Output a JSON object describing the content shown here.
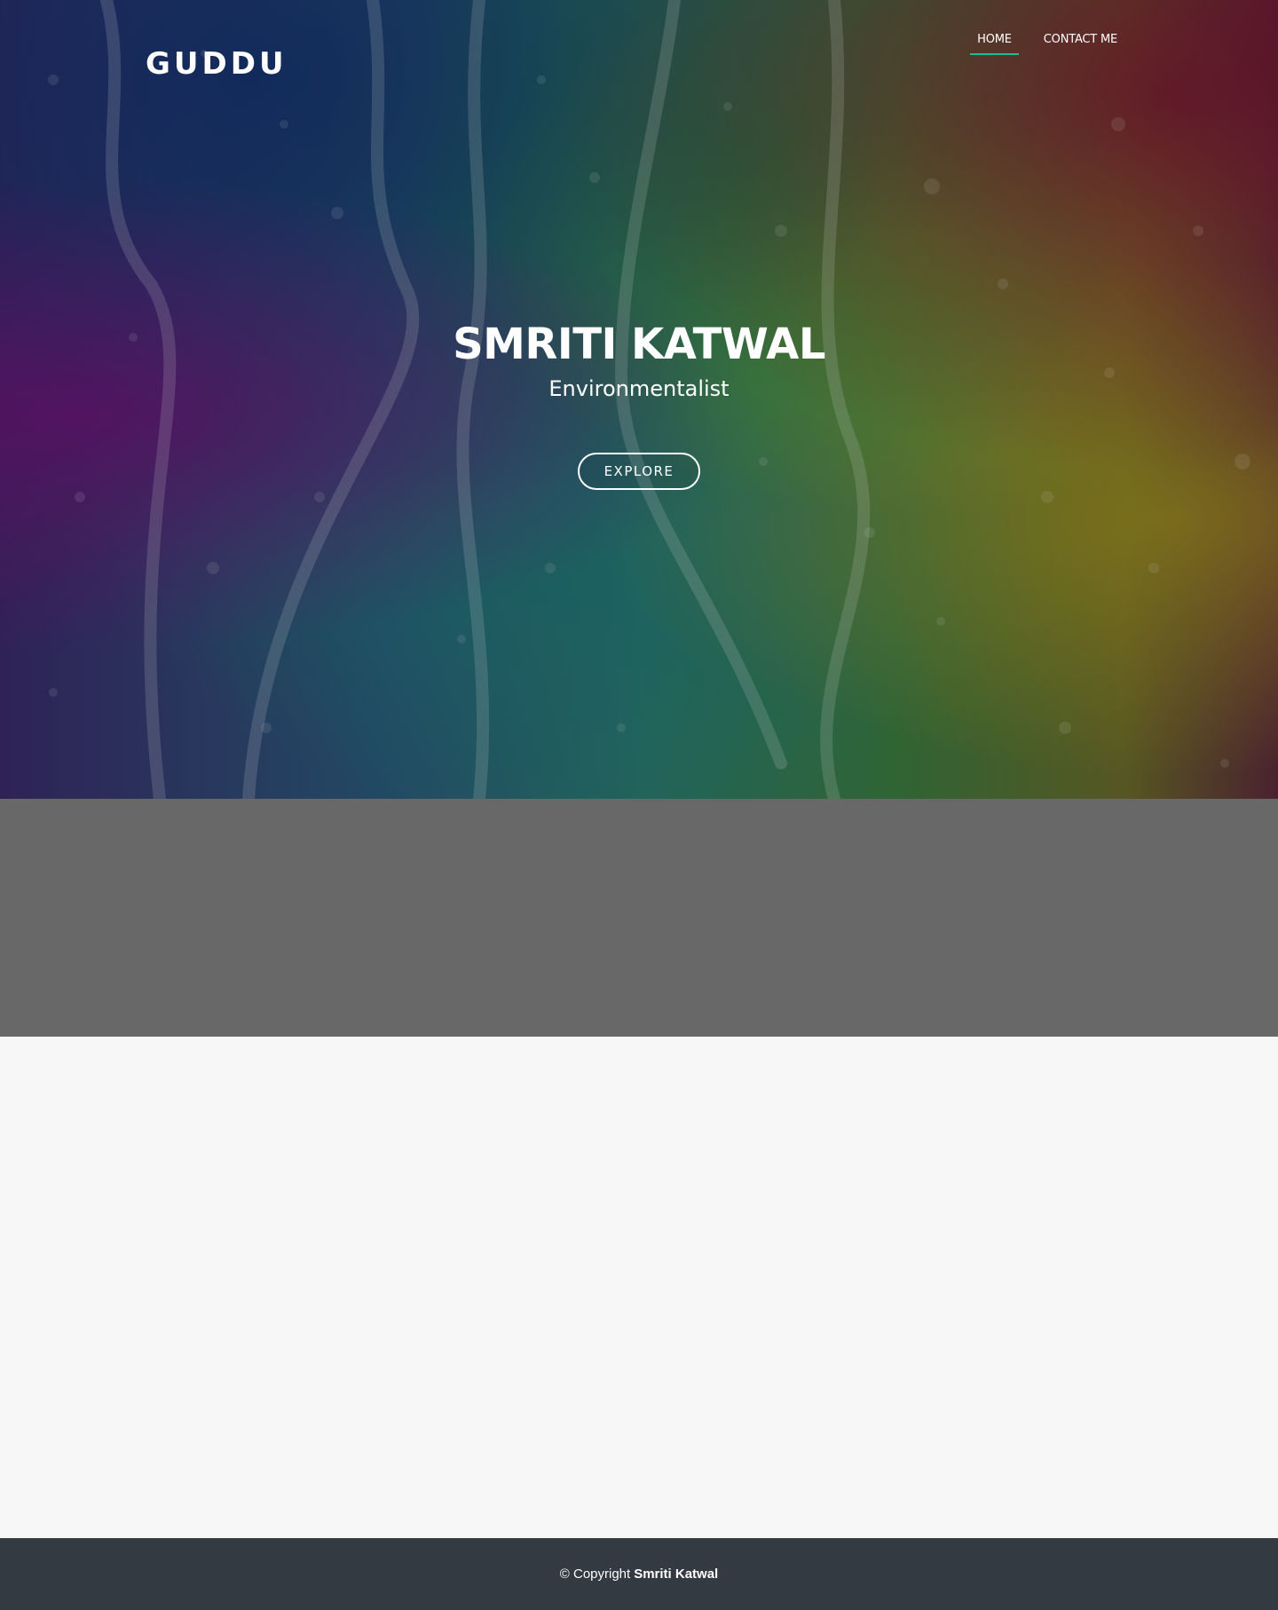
{
  "header": {
    "logo": "GUDDU",
    "nav": [
      {
        "label": "HOME",
        "active": true
      },
      {
        "label": "CONTACT ME",
        "active": false
      }
    ],
    "active_underline_color": "#1bbd98"
  },
  "hero": {
    "title": "SMRITI KATWAL",
    "subtitle": "Environmentalist",
    "button_label": "EXPLORE"
  },
  "footer": {
    "copyright_prefix": "© Copyright",
    "owner": "Smriti Katwal",
    "background": "#343a41"
  }
}
